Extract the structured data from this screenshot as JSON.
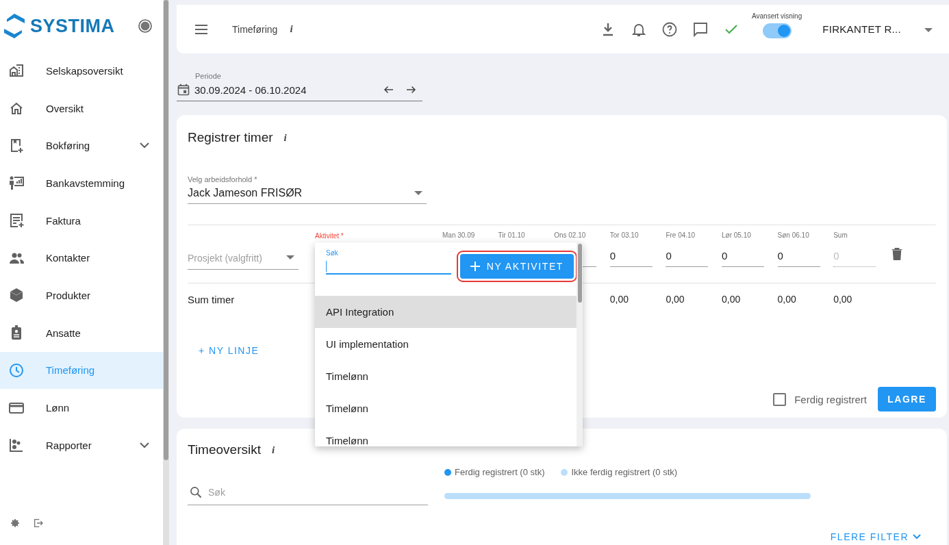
{
  "sidebar": {
    "brand": "SYSTIMA",
    "items": [
      {
        "label": "Selskapsoversikt",
        "selected": false,
        "expandable": false
      },
      {
        "label": "Oversikt",
        "selected": false,
        "expandable": false
      },
      {
        "label": "Bokføring",
        "selected": false,
        "expandable": true
      },
      {
        "label": "Bankavstemming",
        "selected": false,
        "expandable": false
      },
      {
        "label": "Faktura",
        "selected": false,
        "expandable": false
      },
      {
        "label": "Kontakter",
        "selected": false,
        "expandable": false
      },
      {
        "label": "Produkter",
        "selected": false,
        "expandable": false
      },
      {
        "label": "Ansatte",
        "selected": false,
        "expandable": false
      },
      {
        "label": "Timeføring",
        "selected": true,
        "expandable": false
      },
      {
        "label": "Lønn",
        "selected": false,
        "expandable": false
      },
      {
        "label": "Rapporter",
        "selected": false,
        "expandable": true
      }
    ]
  },
  "top_bar": {
    "title": "Timeføring",
    "info": "i",
    "toggle": {
      "label": "Avansert visning",
      "on": true
    },
    "company": "FIRKANTET R..."
  },
  "period": {
    "label": "Periode",
    "value": "30.09.2024 - 06.10.2024"
  },
  "register": {
    "title": "Registrer timer",
    "info": "i",
    "employment": {
      "label": "Velg arbeidsforhold *",
      "value": "Jack Jameson FRISØR"
    },
    "project": {
      "placeholder": "Prosjekt (valgfritt)"
    },
    "activity_label": "Aktivitet *",
    "days": [
      {
        "header": "Man 30.09"
      },
      {
        "header": "Tir 01.10"
      },
      {
        "header": "Ons 02.10"
      },
      {
        "header": "Tor 03.10",
        "value": "0",
        "total": "0,00"
      },
      {
        "header": "Fre 04.10",
        "value": "0",
        "total": "0,00"
      },
      {
        "header": "Lør 05.10",
        "value": "0",
        "total": "0,00"
      },
      {
        "header": "Søn 06.10",
        "value": "0",
        "total": "0,00"
      }
    ],
    "sum": {
      "header": "Sum",
      "placeholder": "0",
      "total": "0,00"
    },
    "sum_label": "Sum timer",
    "new_line": "+ NY LINJE",
    "done": {
      "label": "Ferdig registrert",
      "checked": false
    },
    "save": "LAGRE"
  },
  "activity_menu": {
    "search_label": "Søk",
    "new_button": "NY AKTIVITET",
    "options": [
      {
        "label": "API Integration",
        "selected": true
      },
      {
        "label": "UI implementation",
        "selected": false
      },
      {
        "label": "Timelønn",
        "selected": false
      },
      {
        "label": "Timelønn",
        "selected": false
      },
      {
        "label": "Timelønn",
        "selected": false
      }
    ]
  },
  "overview": {
    "title": "Timeoversikt",
    "info": "i",
    "search": {
      "placeholder": "Søk"
    },
    "legend": [
      {
        "label": "Ferdig registrert (0 stk)",
        "color": "#2196f3"
      },
      {
        "label": "Ikke ferdig registrert (0 stk)",
        "color": "#bbdefb"
      }
    ],
    "progress": {
      "level": 0
    },
    "more_filters": "FLERE FILTER"
  }
}
